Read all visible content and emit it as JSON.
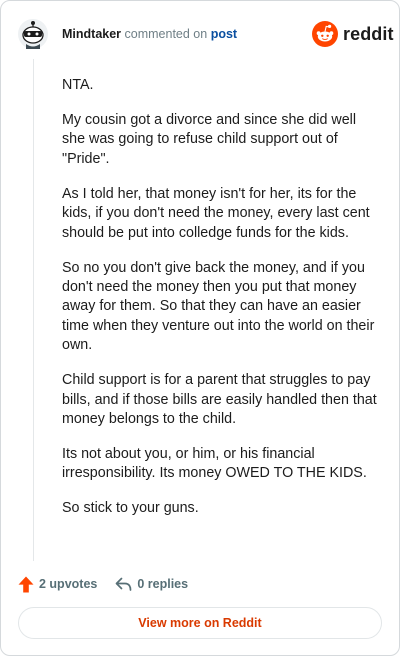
{
  "comment": {
    "author": "Mindtaker",
    "action_text": "commented on",
    "link_text": "post",
    "avatar_icon": "snoo-avatar-icon",
    "paragraphs": [
      "NTA.",
      "My cousin got a divorce and since she did well she was going to refuse child support out of \"Pride\".",
      "As I told her, that money isn't for her, its for the kids, if you don't need the money, every last cent should be put into colledge funds for the kids.",
      "So no you don't give back the money, and if you don't need the money then you put that money away for them. So that they can have an easier time when they venture out into the world on their own.",
      "Child support is for a parent that struggles to pay bills, and if those bills are easily handled then that money belongs to the child.",
      "Its not about you, or him, or his financial irresponsibility. Its money OWED TO THE KIDS.",
      "So stick to your guns."
    ],
    "upvotes_label": "2 upvotes",
    "replies_label": "0 replies"
  },
  "brand": {
    "name": "reddit",
    "logo_icon": "reddit-logo-icon",
    "accent_color": "#ff4500"
  },
  "footer": {
    "view_more_label": "View more on Reddit"
  },
  "icons": {
    "upvote": "upvote-arrow-icon",
    "reply": "reply-arrow-icon"
  }
}
